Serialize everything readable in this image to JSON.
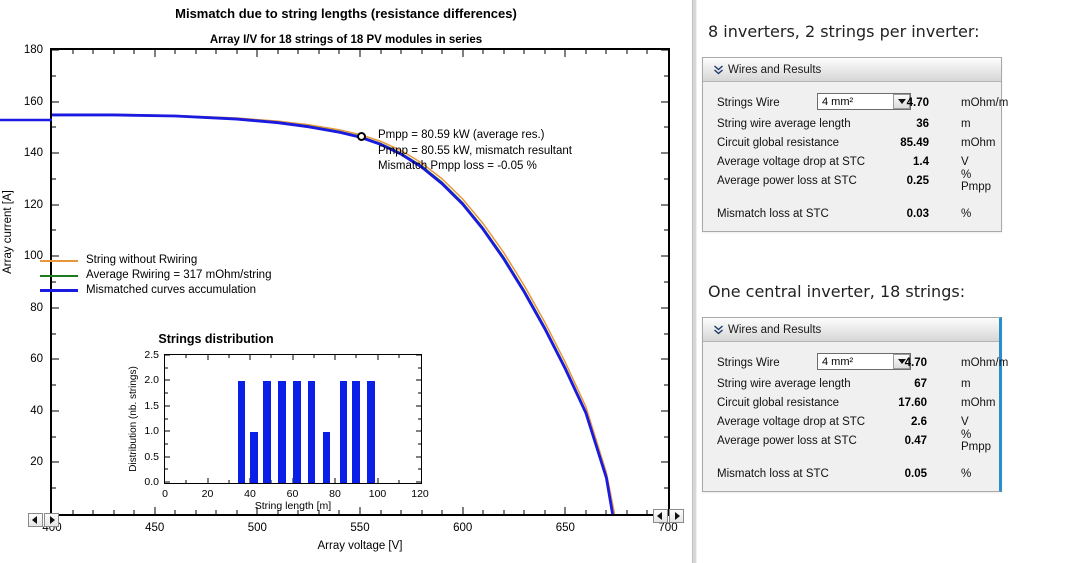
{
  "chart_data": {
    "type": "line",
    "title": "Mismatch due to string lengths (resistance differences)",
    "subtitle": "Array I/V for 18 strings of 18 PV modules in series",
    "xlabel": "Array voltage [V]",
    "ylabel": "Array current [A]",
    "xlim": [
      400,
      700
    ],
    "ylim": [
      0,
      180
    ],
    "xticks": [
      400,
      450,
      500,
      550,
      600,
      650,
      700
    ],
    "yticks": [
      0,
      20,
      40,
      60,
      80,
      100,
      120,
      140,
      160,
      180
    ],
    "grid": false,
    "legend_position": "left-middle",
    "series": [
      {
        "name": "String without Rwiring",
        "color": "#e8963c",
        "x": [
          400,
          430,
          460,
          490,
          510,
          525,
          540,
          550,
          560,
          570,
          580,
          590,
          600,
          610,
          620,
          630,
          640,
          650,
          660,
          670,
          674
        ],
        "y": [
          155.0,
          155.0,
          154.6,
          153.6,
          152.4,
          151.0,
          149.0,
          147.2,
          144.6,
          141.0,
          136.2,
          130.0,
          122.2,
          112.6,
          101.4,
          88.6,
          74.4,
          58.8,
          41.6,
          16.0,
          0.0
        ]
      },
      {
        "name": "Average Rwiring = 317 mOhm/string",
        "color": "#1d7a1d",
        "x": [
          400,
          430,
          460,
          490,
          510,
          525,
          540,
          550,
          560,
          570,
          580,
          590,
          600,
          610,
          620,
          630,
          640,
          650,
          660,
          670,
          673
        ],
        "y": [
          154.8,
          154.8,
          154.4,
          153.3,
          152.0,
          150.5,
          148.4,
          146.5,
          143.8,
          140.0,
          135.1,
          128.7,
          120.8,
          111.0,
          99.7,
          86.8,
          72.6,
          57.0,
          39.8,
          14.4,
          0.0
        ]
      },
      {
        "name": "Mismatched curves accumulation",
        "color": "#1a1ae0",
        "x": [
          400,
          430,
          460,
          490,
          510,
          525,
          540,
          550,
          560,
          570,
          580,
          590,
          600,
          610,
          620,
          630,
          640,
          650,
          660,
          670,
          673
        ],
        "y": [
          154.8,
          154.8,
          154.4,
          153.2,
          151.8,
          150.2,
          148.1,
          146.2,
          143.4,
          139.6,
          134.6,
          128.1,
          120.2,
          110.4,
          99.0,
          86.1,
          71.9,
          56.3,
          39.2,
          14.0,
          0.0
        ]
      }
    ],
    "annotations": [
      "Pmpp = 80.59 kW (average res.)",
      "Pmpp = 80.55 kW, mismatch resultant",
      "Mismatch Pmpp loss = -0.05 %"
    ],
    "mpp_marker": {
      "x": 550,
      "y": 146.5
    }
  },
  "inset_chart": {
    "type": "bar",
    "title": "Strings distribution",
    "xlabel": "String length [m]",
    "ylabel": "Distribution (nb. strings)",
    "xlim": [
      0,
      120
    ],
    "ylim": [
      0,
      2.5
    ],
    "xticks": [
      0,
      20,
      40,
      60,
      80,
      100,
      120
    ],
    "yticks": [
      "0.0",
      "0.5",
      "1.0",
      "1.5",
      "2.0",
      "2.5"
    ],
    "bar_color": "#0a20e8",
    "categories": [
      36,
      42,
      48,
      55,
      62,
      69,
      76,
      84,
      90,
      97
    ],
    "values": [
      2,
      1,
      2,
      2,
      2,
      2,
      1,
      2,
      2,
      2
    ]
  },
  "axis_controls": {
    "left_prev": "◄",
    "left_next": "►",
    "right_prev": "◄",
    "right_next": "►"
  },
  "right": {
    "section1": {
      "heading": "8 inverters, 2 strings per inverter:",
      "panel_title": "Wires and Results",
      "rows": [
        {
          "label": "Strings Wire",
          "value": "4.70",
          "unit": "mOhm/m",
          "select": "4 mm²"
        },
        {
          "label": "String wire average length",
          "value": "36",
          "unit": "m"
        },
        {
          "label": "Circuit global resistance",
          "value": "85.49",
          "unit": "mOhm"
        },
        {
          "label": "Average voltage drop at STC",
          "value": "1.4",
          "unit": "V"
        },
        {
          "label": "Average power loss at STC",
          "value": "0.25",
          "unit": "% Pmpp"
        },
        {
          "label": "Mismatch loss at STC",
          "value": "0.03",
          "unit": "%"
        }
      ]
    },
    "section2": {
      "heading": "One central inverter, 18 strings:",
      "panel_title": "Wires and Results",
      "rows": [
        {
          "label": "Strings Wire",
          "value": "4.70",
          "unit": "mOhm/m",
          "select": "4 mm²"
        },
        {
          "label": "String wire average length",
          "value": "67",
          "unit": "m"
        },
        {
          "label": "Circuit global resistance",
          "value": "17.60",
          "unit": "mOhm"
        },
        {
          "label": "Average voltage drop at STC",
          "value": "2.6",
          "unit": "V"
        },
        {
          "label": "Average power loss at STC",
          "value": "0.47",
          "unit": "% Pmpp"
        },
        {
          "label": "Mismatch loss at STC",
          "value": "0.05",
          "unit": "%"
        }
      ]
    }
  },
  "colors": {
    "orange": "#e8963c",
    "green": "#1d7a1d",
    "blue": "#1a1ae0",
    "bar": "#0a20e8",
    "focus": "#2a8ecb"
  }
}
